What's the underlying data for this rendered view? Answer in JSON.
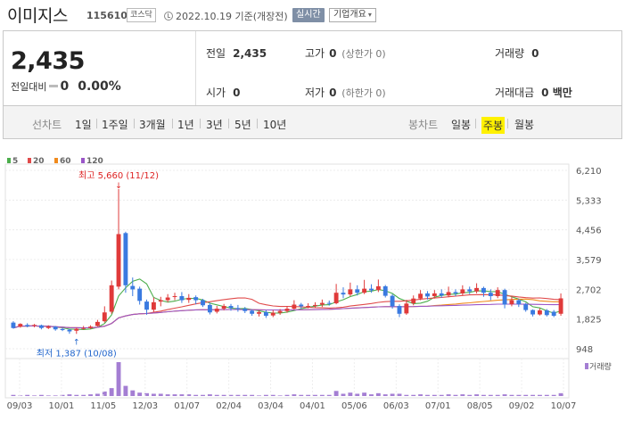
{
  "header": {
    "company_name": "이미지스",
    "stock_code": "115610",
    "market": "코스닥",
    "date_text": "2022.10.19 기준(개장전)",
    "realtime_label": "실시간",
    "company_info_label": "기업개요"
  },
  "price": {
    "current": "2,435",
    "prev_diff_label": "전일대비",
    "diff_value": "0",
    "diff_pct": "0.00%"
  },
  "stats": {
    "prev_close_label": "전일",
    "prev_close": "2,435",
    "high_label": "고가",
    "high": "0",
    "high_sub": "(상한가 0)",
    "volume_label": "거래량",
    "volume": "0",
    "open_label": "시가",
    "open": "0",
    "low_label": "저가",
    "low": "0",
    "low_sub": "(하한가 0)",
    "amount_label": "거래대금",
    "amount": "0 백만"
  },
  "period_bar": {
    "line_label": "선차트",
    "line_periods": [
      "1일",
      "1주일",
      "3개월",
      "1년",
      "3년",
      "5년",
      "10년"
    ],
    "candle_label": "봉차트",
    "candle_periods": [
      "일봉",
      "주봉",
      "월봉"
    ],
    "selected_candle": "주봉"
  },
  "colors": {
    "up": "#e03a3a",
    "down": "#3a7ae0",
    "ma5": "#4cae4c",
    "ma20": "#e04a4a",
    "ma60": "#f08a1c",
    "ma120": "#9a55c8",
    "volume": "#a47ed3",
    "highlight": "#fff100"
  },
  "chart_data": {
    "type": "candlestick",
    "legend": [
      "5",
      "20",
      "60",
      "120"
    ],
    "y_ticks": [
      "6,210",
      "5,333",
      "4,456",
      "3,579",
      "2,702",
      "1,825",
      "948"
    ],
    "ylim": [
      948,
      6210
    ],
    "x_labels": [
      "09/03",
      "10/01",
      "11/05",
      "12/03",
      "01/07",
      "02/04",
      "03/04",
      "04/01",
      "05/06",
      "06/03",
      "07/01",
      "08/05",
      "09/02",
      "10/07"
    ],
    "high_note": "최고 5,660 (11/12)",
    "low_note": "최저 1,387 (10/08)",
    "volume_label": "거래량",
    "candles": [
      [
        1720,
        1560,
        1760,
        1540
      ],
      [
        1600,
        1680,
        1700,
        1570
      ],
      [
        1650,
        1610,
        1700,
        1580
      ],
      [
        1620,
        1650,
        1680,
        1580
      ],
      [
        1640,
        1560,
        1660,
        1520
      ],
      [
        1560,
        1600,
        1640,
        1530
      ],
      [
        1600,
        1520,
        1620,
        1480
      ],
      [
        1530,
        1500,
        1570,
        1470
      ],
      [
        1510,
        1460,
        1530,
        1390
      ],
      [
        1480,
        1540,
        1570,
        1387
      ],
      [
        1540,
        1560,
        1620,
        1510
      ],
      [
        1560,
        1600,
        1640,
        1530
      ],
      [
        1620,
        1740,
        1800,
        1600
      ],
      [
        1760,
        2020,
        2200,
        1720
      ],
      [
        2040,
        2820,
        2960,
        1980
      ],
      [
        2780,
        4330,
        5660,
        2700
      ],
      [
        4360,
        2820,
        4400,
        2600
      ],
      [
        2800,
        2700,
        3050,
        2500
      ],
      [
        2720,
        2360,
        2780,
        2250
      ],
      [
        2340,
        2100,
        2400,
        1950
      ],
      [
        2100,
        2320,
        2460,
        2040
      ],
      [
        2340,
        2380,
        2480,
        2200
      ],
      [
        2380,
        2460,
        2560,
        2320
      ],
      [
        2480,
        2500,
        2600,
        2380
      ],
      [
        2500,
        2380,
        2620,
        2300
      ],
      [
        2390,
        2450,
        2560,
        2300
      ],
      [
        2470,
        2380,
        2520,
        2260
      ],
      [
        2380,
        2230,
        2420,
        2180
      ],
      [
        2240,
        2020,
        2300,
        1960
      ],
      [
        2040,
        2130,
        2210,
        1990
      ],
      [
        2130,
        2210,
        2270,
        2080
      ],
      [
        2210,
        2150,
        2270,
        2070
      ],
      [
        2150,
        2130,
        2240,
        2040
      ],
      [
        2130,
        2060,
        2180,
        2000
      ],
      [
        2070,
        1980,
        2110,
        1920
      ],
      [
        1980,
        2030,
        2080,
        1900
      ],
      [
        2030,
        1920,
        2080,
        1860
      ],
      [
        1930,
        2010,
        2090,
        1880
      ],
      [
        2010,
        2060,
        2120,
        1950
      ],
      [
        2060,
        2130,
        2210,
        2010
      ],
      [
        2130,
        2250,
        2380,
        2100
      ],
      [
        2250,
        2200,
        2300,
        2130
      ],
      [
        2200,
        2210,
        2290,
        2140
      ],
      [
        2210,
        2240,
        2320,
        2160
      ],
      [
        2250,
        2300,
        2400,
        2180
      ],
      [
        2300,
        2290,
        2370,
        2220
      ],
      [
        2290,
        2600,
        2860,
        2260
      ],
      [
        2600,
        2550,
        2760,
        2440
      ],
      [
        2550,
        2700,
        2900,
        2500
      ],
      [
        2700,
        2600,
        2820,
        2520
      ],
      [
        2600,
        2720,
        2980,
        2560
      ],
      [
        2720,
        2670,
        2850,
        2600
      ],
      [
        2680,
        2790,
        2990,
        2620
      ],
      [
        2790,
        2510,
        2830,
        2460
      ],
      [
        2510,
        2200,
        2560,
        2130
      ],
      [
        2210,
        1980,
        2260,
        1880
      ],
      [
        1990,
        2280,
        2390,
        1950
      ],
      [
        2290,
        2430,
        2520,
        2230
      ],
      [
        2430,
        2570,
        2680,
        2380
      ],
      [
        2580,
        2490,
        2650,
        2400
      ],
      [
        2500,
        2580,
        2680,
        2430
      ],
      [
        2580,
        2520,
        2700,
        2450
      ],
      [
        2520,
        2620,
        2780,
        2470
      ],
      [
        2620,
        2580,
        2700,
        2500
      ],
      [
        2580,
        2700,
        2820,
        2520
      ],
      [
        2700,
        2640,
        2780,
        2560
      ],
      [
        2640,
        2740,
        2880,
        2580
      ],
      [
        2740,
        2600,
        2780,
        2480
      ],
      [
        2600,
        2500,
        2700,
        2380
      ],
      [
        2500,
        2680,
        2760,
        2440
      ],
      [
        2680,
        2250,
        2720,
        2140
      ],
      [
        2260,
        2380,
        2480,
        2200
      ],
      [
        2380,
        2260,
        2420,
        2180
      ],
      [
        2260,
        2090,
        2300,
        2040
      ],
      [
        2090,
        1960,
        2110,
        1900
      ],
      [
        1960,
        2080,
        2140,
        1930
      ],
      [
        2080,
        1940,
        2120,
        1900
      ],
      [
        2040,
        1920,
        2090,
        1880
      ],
      [
        1980,
        2435,
        2580,
        1920
      ]
    ],
    "volumes": [
      2,
      1,
      2,
      1,
      2,
      1,
      1,
      2,
      3,
      2,
      2,
      3,
      4,
      8,
      14,
      60,
      18,
      10,
      6,
      5,
      4,
      4,
      3,
      3,
      3,
      3,
      2,
      2,
      3,
      2,
      2,
      2,
      2,
      2,
      2,
      1,
      2,
      2,
      1,
      2,
      3,
      2,
      2,
      2,
      2,
      2,
      9,
      4,
      6,
      4,
      6,
      3,
      5,
      3,
      4,
      4,
      2,
      2,
      3,
      2,
      2,
      2,
      3,
      2,
      3,
      2,
      3,
      2,
      2,
      2,
      3,
      2,
      2,
      2,
      2,
      2,
      2,
      2,
      5
    ]
  }
}
